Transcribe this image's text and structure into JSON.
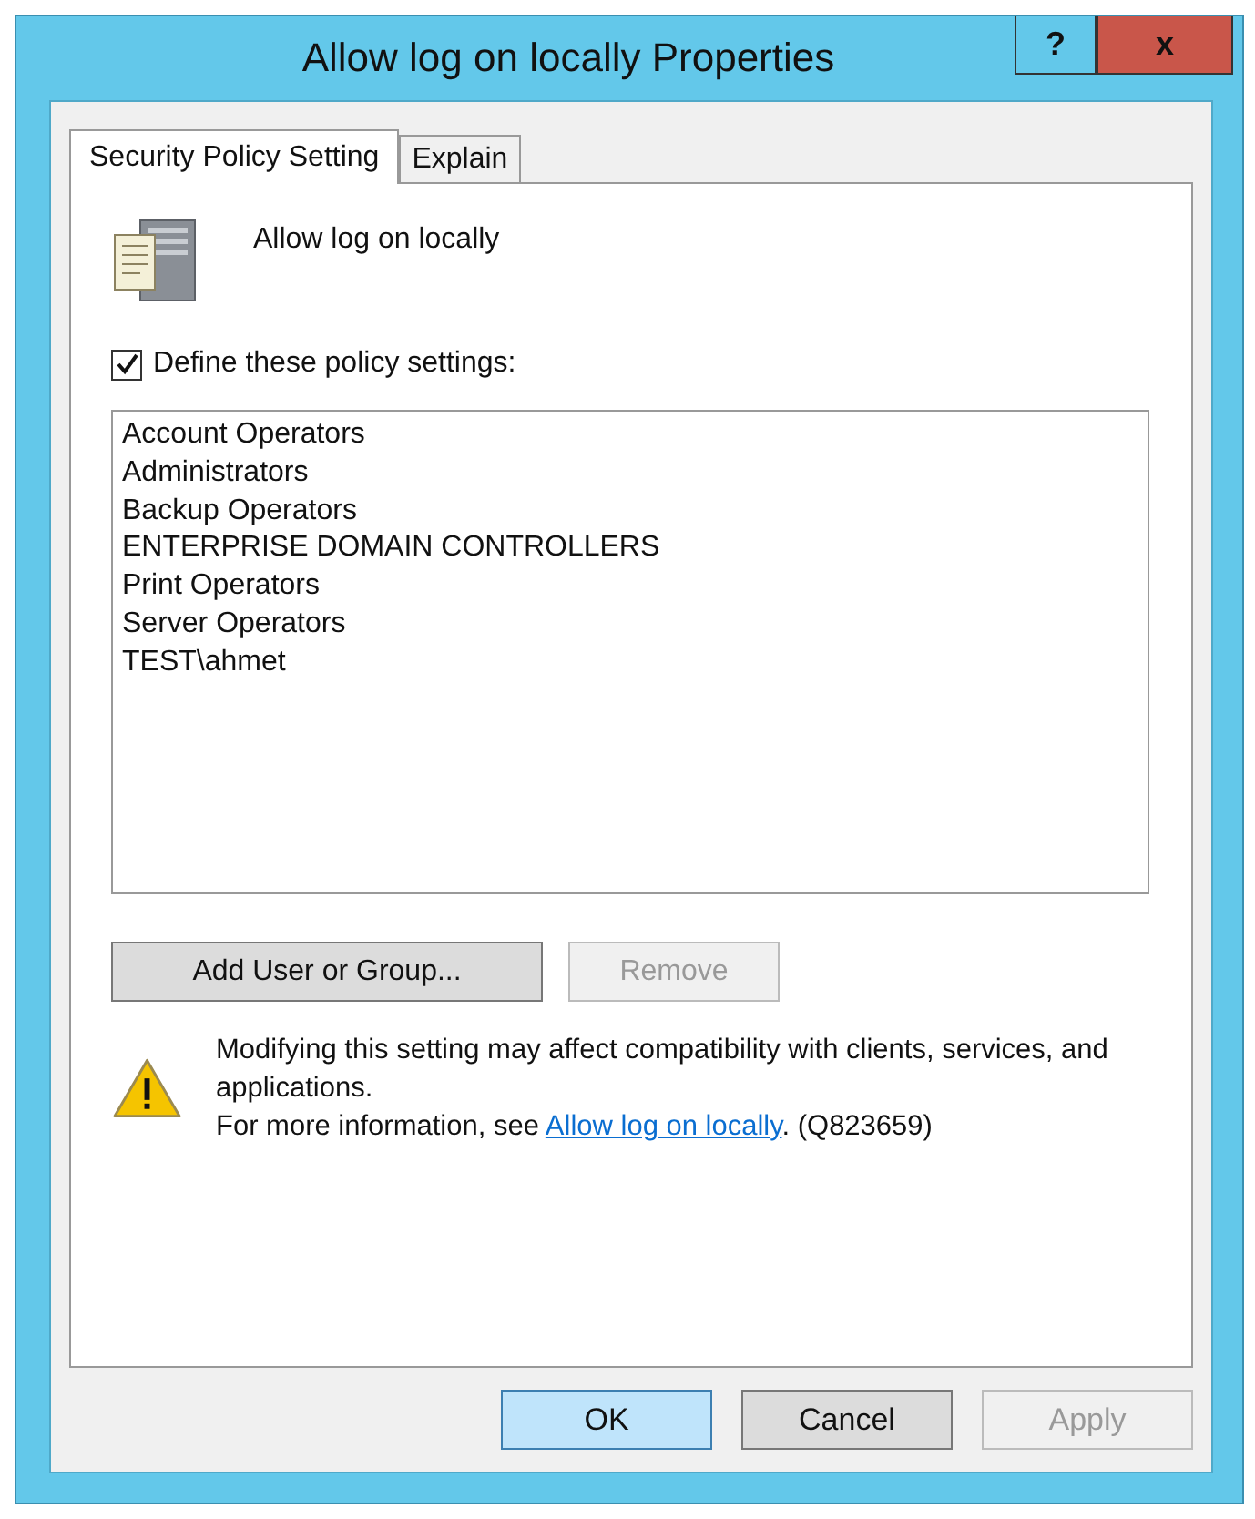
{
  "window": {
    "title": "Allow log on locally Properties",
    "help_button": "?",
    "close_button": "x"
  },
  "tabs": [
    {
      "label": "Security Policy Setting",
      "selected": true
    },
    {
      "label": "Explain",
      "selected": false
    }
  ],
  "policy_name": "Allow log on locally",
  "define_checkbox": {
    "label": "Define these policy settings:",
    "checked": true
  },
  "members": [
    "Account Operators",
    "Administrators",
    "Backup Operators",
    "ENTERPRISE DOMAIN CONTROLLERS",
    "Print Operators",
    "Server Operators",
    "TEST\\ahmet"
  ],
  "member_buttons": [
    {
      "label": "Add User or Group...",
      "disabled": false
    },
    {
      "label": "Remove",
      "disabled": true
    }
  ],
  "warning": {
    "text": "Modifying this setting may affect compatibility with clients, services, and applications.",
    "more_prefix": "For more information, see ",
    "link": "Allow log on locally",
    "more_suffix": ". (Q823659)"
  },
  "footer_buttons": [
    {
      "label": "OK",
      "kind": "default",
      "disabled": false
    },
    {
      "label": "Cancel",
      "kind": "normal",
      "disabled": false
    },
    {
      "label": "Apply",
      "kind": "normal",
      "disabled": true
    }
  ]
}
